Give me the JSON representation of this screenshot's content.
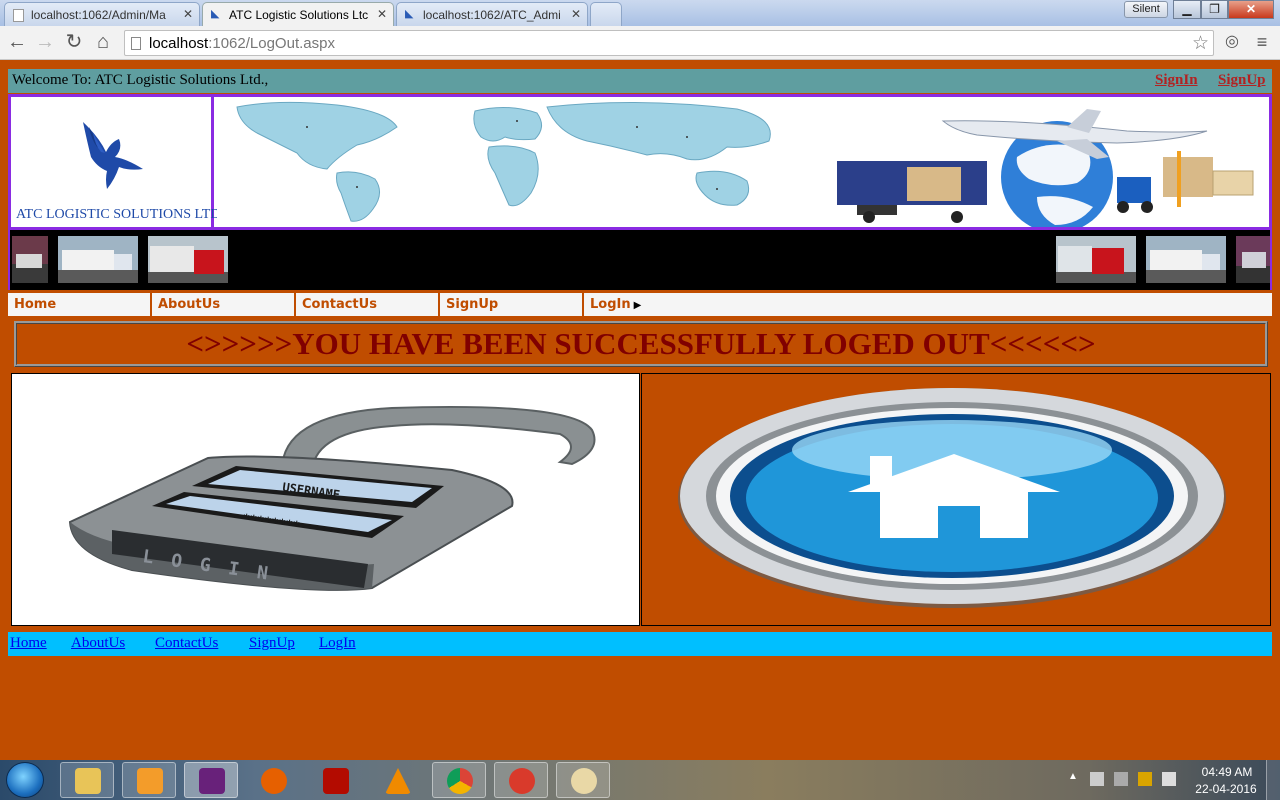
{
  "browser": {
    "tabs": [
      {
        "title": "localhost:1062/Admin/Ma",
        "active": false
      },
      {
        "title": "ATC Logistic Solutions Ltc",
        "active": true
      },
      {
        "title": "localhost:1062/ATC_Admi",
        "active": false
      }
    ],
    "profile_label": "Silent",
    "url_host": "localhost",
    "url_rest": ":1062/LogOut.aspx"
  },
  "page": {
    "welcome_text": "Welcome To: ATC Logistic Solutions Ltd.,",
    "top_links": {
      "signin": "SignIn",
      "signup": "SignUp"
    },
    "logo_text": "ATC LOGISTIC SOLUTIONS LTD.,",
    "menu": [
      {
        "label": "Home"
      },
      {
        "label": "AboutUs"
      },
      {
        "label": "ContactUs"
      },
      {
        "label": "SignUp"
      },
      {
        "label": "LogIn"
      }
    ],
    "message": "<>>>>>YOU HAVE BEEN SUCCESSFULLY LOGED OUT<<<<<>",
    "login_image_words": {
      "username": "USERNAME",
      "password": "********",
      "login": "LOGIN"
    },
    "footer_links": [
      {
        "label": "Home"
      },
      {
        "label": "AboutUs"
      },
      {
        "label": "ContactUs"
      },
      {
        "label": "SignUp"
      },
      {
        "label": "LogIn"
      }
    ],
    "colors": {
      "page_bg": "#c04d00",
      "top_bar": "#5f9ea0",
      "banner_border": "#8a2be2",
      "message_text": "#800000",
      "footer_bg": "#00bfff"
    }
  },
  "taskbar": {
    "apps": [
      "file-explorer-icon",
      "media-player-icon",
      "visual-studio-icon",
      "firefox-icon",
      "acrobat-icon",
      "vlc-icon",
      "chrome-icon",
      "ccleaner-icon",
      "paint-icon"
    ],
    "time": "04:49 AM",
    "date": "22-04-2016"
  }
}
